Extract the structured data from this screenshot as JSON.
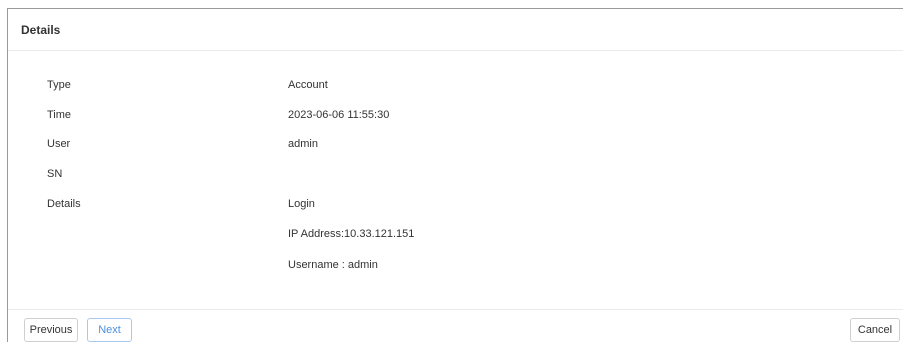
{
  "dialog": {
    "title": "Details"
  },
  "fields": [
    {
      "label": "Type",
      "value": "Account"
    },
    {
      "label": "Time",
      "value": "2023-06-06 11:55:30"
    },
    {
      "label": "User",
      "value": "admin"
    },
    {
      "label": "SN",
      "value": ""
    },
    {
      "label": "Details",
      "value": "Login"
    }
  ],
  "details_extra": [
    "IP Address:10.33.121.151",
    "Username : admin"
  ],
  "footer": {
    "previous_label": "Previous",
    "next_label": "Next",
    "cancel_label": "Cancel"
  }
}
